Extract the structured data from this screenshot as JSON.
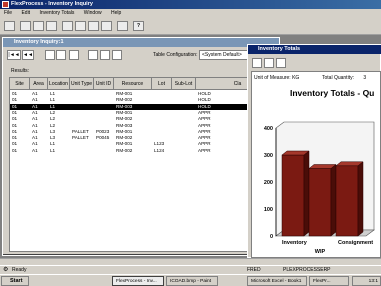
{
  "app": {
    "title": "FlexProcess - Inventory Inquiry"
  },
  "menu": [
    "File",
    "Edit",
    "Inventory Totals",
    "Window",
    "Help"
  ],
  "inquiry": {
    "title": "Inventory Inquiry:1",
    "nav": [
      "|◄◄",
      "◄◄"
    ],
    "table_config_label": "Table Configuration:",
    "table_config_value": "<System Default>",
    "results_label": "Results:",
    "columns": [
      "Site",
      "Area",
      "Location",
      "Unit Type",
      "Unit ID",
      "Resource",
      "Lot",
      "Sub-Lot",
      "Cla"
    ],
    "rows": [
      [
        "01",
        "A1",
        "L1",
        "",
        "",
        "RM-001",
        "",
        "",
        "HOLD"
      ],
      [
        "01",
        "A1",
        "L1",
        "",
        "",
        "RM-002",
        "",
        "",
        "HOLD"
      ],
      [
        "01",
        "A1",
        "L1",
        "",
        "",
        "RM-003",
        "",
        "",
        "HOLD"
      ],
      [
        "01",
        "A1",
        "L2",
        "",
        "",
        "RM-001",
        "",
        "",
        "APPR"
      ],
      [
        "01",
        "A1",
        "L2",
        "",
        "",
        "RM-002",
        "",
        "",
        "APPR"
      ],
      [
        "01",
        "A1",
        "L2",
        "",
        "",
        "RM-003",
        "",
        "",
        "APPR"
      ],
      [
        "01",
        "A1",
        "L3",
        "PALLET",
        "P0023",
        "RM-001",
        "",
        "",
        "APPR"
      ],
      [
        "01",
        "A1",
        "L3",
        "PALLET",
        "P0045",
        "RM-002",
        "",
        "",
        "APPR"
      ],
      [
        "01",
        "A1",
        "L1",
        "",
        "",
        "RM-001",
        "L123",
        "",
        "APPR"
      ],
      [
        "01",
        "A1",
        "L1",
        "",
        "",
        "RM-002",
        "L124",
        "",
        "APPR"
      ]
    ],
    "selected_row": 2
  },
  "totals": {
    "title": "Inventory Totals",
    "uom_label": "Unit of Measure: KG",
    "total_qty_label": "Total Quantity:",
    "total_qty_value": "3"
  },
  "chart_data": {
    "type": "bar",
    "title": "Inventory Totals - Qu",
    "categories": [
      "Inventory",
      "WIP",
      "Consignment"
    ],
    "values": [
      300,
      250,
      260
    ],
    "ylim": [
      0,
      400
    ],
    "yticks": [
      0,
      100,
      200,
      300,
      400
    ],
    "grid": false,
    "bar_color": "#7b1a12"
  },
  "status": {
    "left": "Ready",
    "mid": "FRED",
    "right": "PLEXPROCESSERP"
  },
  "taskbar": {
    "start": "Start",
    "items": [
      "FlexProcess - Inv...",
      "ICOAD.bmp - Paint",
      "Microsoft Excel - Book1",
      "FlexPr..."
    ],
    "clock": "13:1"
  }
}
